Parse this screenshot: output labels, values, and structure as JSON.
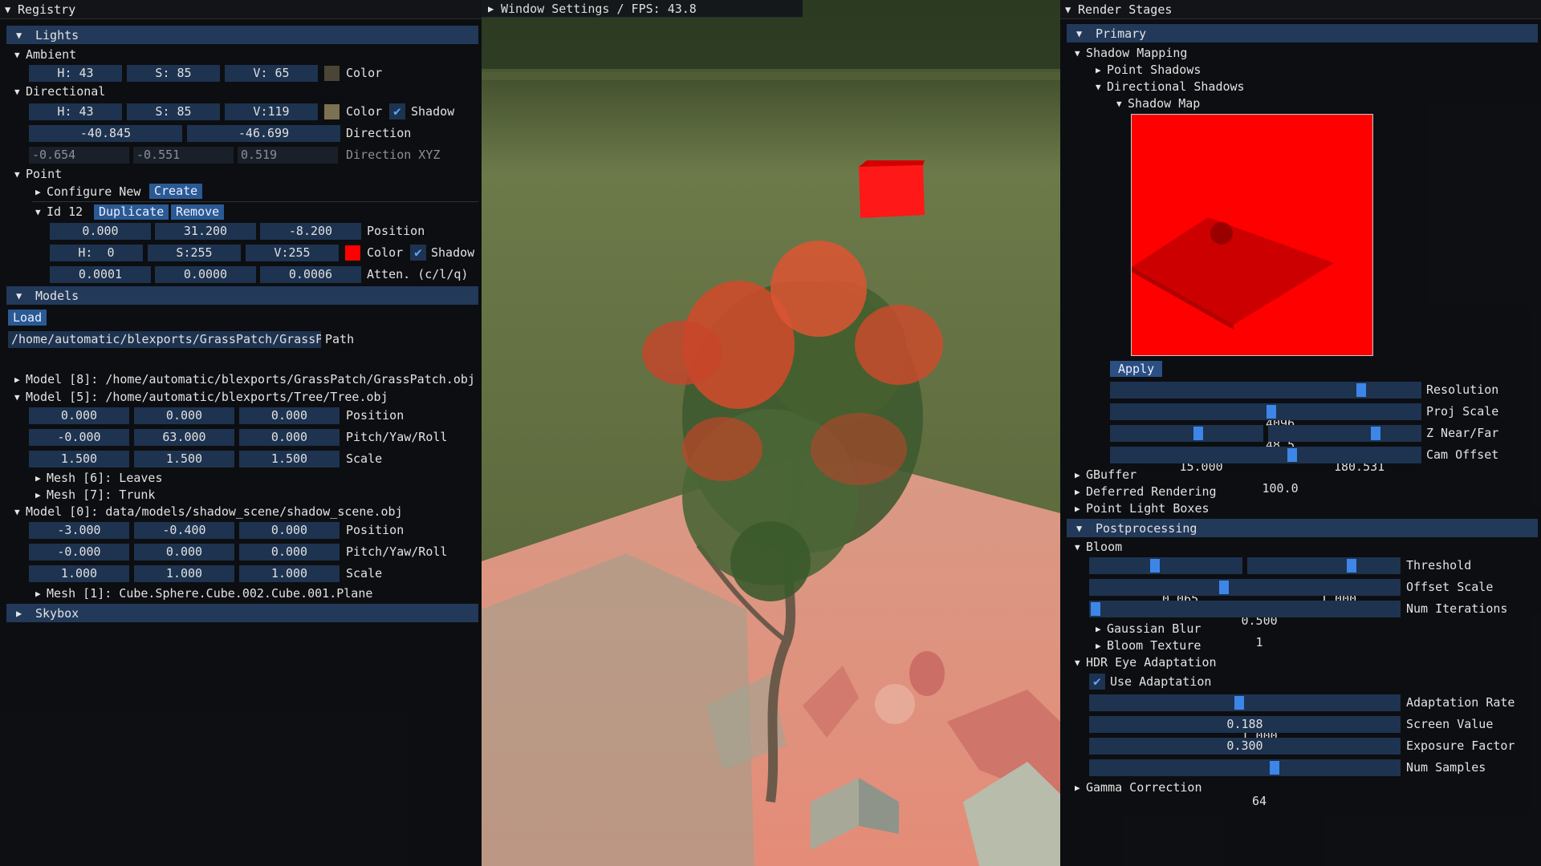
{
  "registry": {
    "title": "Registry",
    "lights": {
      "header": "Lights",
      "ambient": {
        "label": "Ambient",
        "h": "H: 43",
        "s": "S: 85",
        "v": "V: 65",
        "color_label": "Color",
        "swatch": "#4a4535"
      },
      "directional": {
        "label": "Directional",
        "h": "H: 43",
        "s": "S: 85",
        "v": "V:119",
        "color_label": "Color",
        "swatch": "#7a7250",
        "shadow_label": "Shadow",
        "dir1": "-40.845",
        "dir2": "-46.699",
        "dir_label": "Direction",
        "x": "-0.654",
        "y": "-0.551",
        "z": "0.519",
        "xyz_label": "Direction XYZ"
      },
      "point": {
        "label": "Point",
        "configure": "Configure New",
        "create": "Create",
        "id": "Id 12",
        "duplicate": "Duplicate",
        "remove": "Remove",
        "px": "0.000",
        "py": "31.200",
        "pz": "-8.200",
        "pos_label": "Position",
        "h": "H:  0",
        "s": "S:255",
        "v": "V:255",
        "color_label": "Color",
        "swatch": "#ff0000",
        "shadow_label": "Shadow",
        "ac": "0.0001",
        "al": "0.0000",
        "aq": "0.0006",
        "atten_label": "Atten. (c/l/q)"
      }
    },
    "models": {
      "header": "Models",
      "load": "Load",
      "path_value": "/home/automatic/blexports/GrassPatch/GrassPa",
      "path_label": "Path",
      "m8": "Model [8]: /home/automatic/blexports/GrassPatch/GrassPatch.obj",
      "m5": {
        "label": "Model [5]: /home/automatic/blexports/Tree/Tree.obj",
        "pos": [
          "0.000",
          "0.000",
          "0.000"
        ],
        "rot": [
          "-0.000",
          "63.000",
          "0.000"
        ],
        "scale": [
          "1.500",
          "1.500",
          "1.500"
        ],
        "mesh6": "Mesh [6]: Leaves",
        "mesh7": "Mesh [7]: Trunk"
      },
      "m0": {
        "label": "Model [0]: data/models/shadow_scene/shadow_scene.obj",
        "pos": [
          "-3.000",
          "-0.400",
          "0.000"
        ],
        "rot": [
          "-0.000",
          "0.000",
          "0.000"
        ],
        "scale": [
          "1.000",
          "1.000",
          "1.000"
        ],
        "mesh1": "Mesh [1]: Cube.Sphere.Cube.002.Cube.001.Plane"
      },
      "position_label": "Position",
      "pyr_label": "Pitch/Yaw/Roll",
      "scale_label": "Scale"
    },
    "skybox": "Skybox"
  },
  "window_settings": "Window Settings / FPS: 43.8",
  "render": {
    "title": "Render Stages",
    "primary": "Primary",
    "shadow_mapping": "Shadow Mapping",
    "point_shadows": "Point Shadows",
    "directional_shadows": "Directional Shadows",
    "shadow_map": "Shadow Map",
    "apply": "Apply",
    "resolution": {
      "value": "4096",
      "label": "Resolution",
      "frac": 0.82
    },
    "proj_scale": {
      "value": "48.5",
      "label": "Proj Scale",
      "frac": 0.52
    },
    "near": {
      "value": "15.000",
      "frac": 0.58
    },
    "far": {
      "value": "180.531",
      "frac": 0.72
    },
    "near_far_label": "Z Near/Far",
    "cam_offset": {
      "value": "100.0",
      "label": "Cam Offset",
      "frac": 0.59
    },
    "gbuffer": "GBuffer",
    "deferred": "Deferred Rendering",
    "point_light_boxes": "Point Light Boxes",
    "postprocessing": "Postprocessing",
    "bloom": "Bloom",
    "threshold": {
      "v1": "0.065",
      "f1": 0.42,
      "v2": "1.000",
      "f2": 0.7,
      "label": "Threshold"
    },
    "offset_scale": {
      "value": "0.500",
      "label": "Offset Scale",
      "frac": 0.43
    },
    "num_iterations": {
      "value": "1",
      "label": "Num Iterations",
      "frac": 0.0
    },
    "gaussian_blur": "Gaussian Blur",
    "bloom_texture": "Bloom Texture",
    "hdr": "HDR Eye Adaptation",
    "use_adaptation": "Use Adaptation",
    "adaptation_rate": {
      "value": "1.000",
      "label": "Adaptation Rate",
      "frac": 0.48
    },
    "screen_value": {
      "value": "0.188",
      "label": "Screen Value"
    },
    "exposure_factor": {
      "value": "0.300",
      "label": "Exposure Factor"
    },
    "num_samples": {
      "value": "64",
      "label": "Num Samples",
      "frac": 0.6
    },
    "gamma": "Gamma Correction"
  }
}
